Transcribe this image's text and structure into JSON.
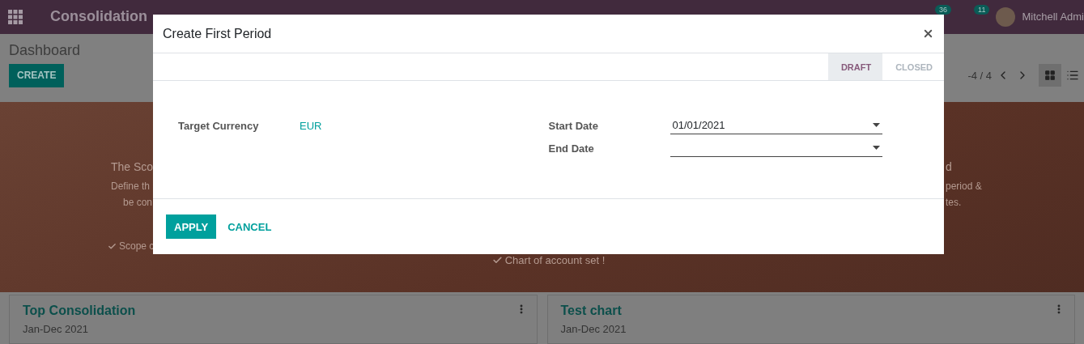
{
  "navbar": {
    "app_title": "Consolidation",
    "badges": [
      {
        "count": "36"
      },
      {
        "count": "11"
      }
    ],
    "user": "Mitchell Admi"
  },
  "control_panel": {
    "breadcrumb": "Dashboard",
    "create_button": "CREATE",
    "pager": "-4 / 4",
    "views": [
      {
        "kind": "kanban",
        "selected": true
      },
      {
        "kind": "list",
        "selected": false
      }
    ]
  },
  "hero": {
    "left_fragments": [
      "The Sco",
      "Define th",
      "be con"
    ],
    "left_check": "Scope c",
    "right_fragments": [
      "d",
      "period &",
      "tes."
    ],
    "center_check": "Chart of account set !"
  },
  "cards": [
    {
      "title": "Top Consolidation",
      "subtitle": "Jan-Dec 2021"
    },
    {
      "title": "Test chart",
      "subtitle": "Jan-Dec 2021"
    }
  ],
  "dialog": {
    "title": "Create First Period",
    "status": [
      {
        "label": "DRAFT",
        "selected": true
      },
      {
        "label": "CLOSED",
        "selected": false
      }
    ],
    "fields": [
      {
        "label": "Target Currency",
        "value": "EUR",
        "kind": "link"
      },
      {
        "label": "Start Date",
        "value": "01/01/2021",
        "kind": "date"
      },
      {
        "label": "End Date",
        "kind": "date"
      }
    ],
    "buttons": [
      {
        "label": "APPLY",
        "kind": "primary"
      },
      {
        "label": "CANCEL",
        "kind": "link"
      }
    ]
  }
}
